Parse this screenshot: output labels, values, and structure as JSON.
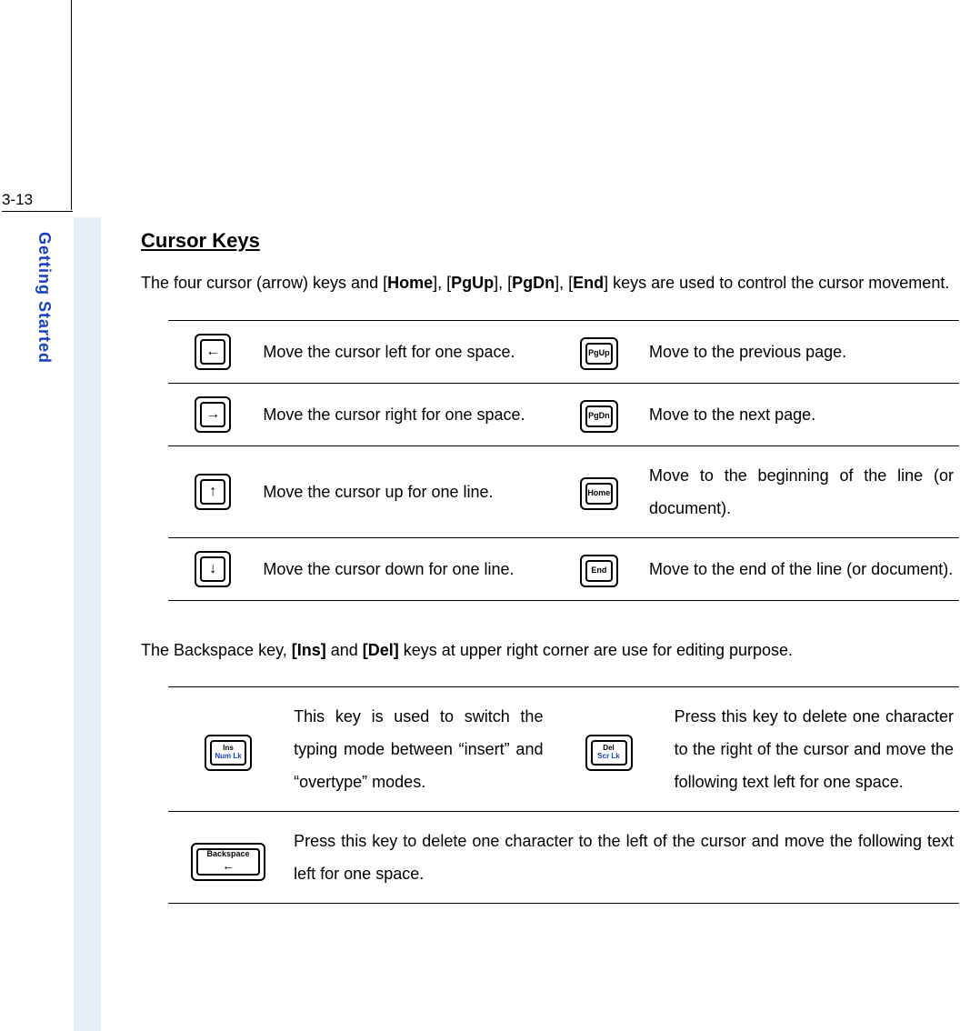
{
  "page_number": "3-13",
  "sidebar": "Getting Started",
  "heading": "Cursor Keys",
  "intro_pre": "The four cursor (arrow) keys and [",
  "intro_k1": "Home",
  "intro_m1": "], [",
  "intro_k2": "PgUp",
  "intro_m2": "], [",
  "intro_k3": "PgDn",
  "intro_m3": "], [",
  "intro_k4": "End",
  "intro_post": "] keys are used to control the cursor movement.",
  "rows": [
    {
      "icon1": "←",
      "desc1": "Move the cursor left for one space.",
      "icon2": "PgUp",
      "desc2": "Move to the previous page."
    },
    {
      "icon1": "→",
      "desc1": "Move the cursor right for one space.",
      "icon2": "PgDn",
      "desc2": "Move to the next page."
    },
    {
      "icon1": "↑",
      "desc1": "Move the cursor up for one line.",
      "icon2": "Home",
      "desc2": "Move to the beginning of the line (or document)."
    },
    {
      "icon1": "↓",
      "desc1": "Move the cursor down for one line.",
      "icon2": "End",
      "desc2": "Move to the end of the line (or document)."
    }
  ],
  "intro2_pre": "The Backspace key, ",
  "intro2_k1": "[Ins]",
  "intro2_m1": " and ",
  "intro2_k2": "[Del]",
  "intro2_post": " keys at upper right corner are use for editing purpose.",
  "edit_rows": [
    {
      "icon1a": "Ins",
      "icon1b": "Num Lk",
      "desc1": "This key is used to switch the typing mode between “insert” and “overtype” modes.",
      "icon2a": "Del",
      "icon2b": "Scr Lk",
      "desc2": "Press this key to delete one character to the right of the cursor and move the following text left for one space."
    }
  ],
  "backspace": {
    "label1": "Backspace",
    "label2": "←",
    "desc": "Press this key to delete one character to the left of the cursor and move the following text left for one space."
  }
}
